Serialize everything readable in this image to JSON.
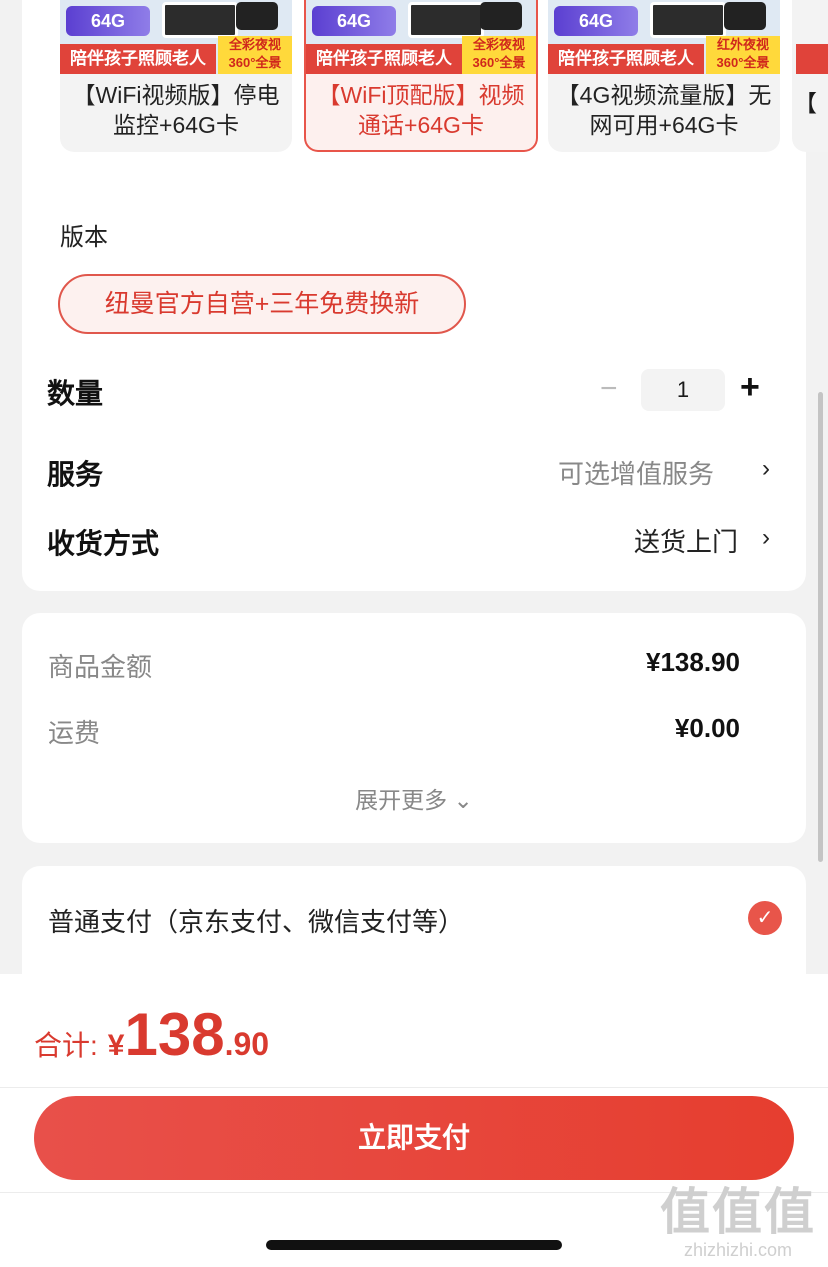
{
  "variants": [
    {
      "badge": "64G",
      "banner_left": "陪伴孩子照顾老人",
      "banner_right": "全彩夜视\n360°全景",
      "label": "【WiFi视频版】停电监控+64G卡",
      "selected": false
    },
    {
      "badge": "64G",
      "banner_left": "陪伴孩子照顾老人",
      "banner_right": "全彩夜视\n360°全景",
      "label": "【WiFi顶配版】视频通话+64G卡",
      "selected": true
    },
    {
      "badge": "64G",
      "banner_left": "陪伴孩子照顾老人",
      "banner_right": "红外夜视\n360°全景",
      "label": "【4G视频流量版】无网可用+64G卡",
      "selected": false
    },
    {
      "label": "【"
    }
  ],
  "version": {
    "title": "版本",
    "selected": "纽曼官方自营+三年免费换新"
  },
  "quantity": {
    "label": "数量",
    "minus": "−",
    "value": "1",
    "plus": "+"
  },
  "service": {
    "label": "服务",
    "value": "可选增值服务",
    "chevron": "›"
  },
  "delivery": {
    "label": "收货方式",
    "value": "送货上门",
    "chevron": "›"
  },
  "fees": {
    "goods_label": "商品金额",
    "goods_value": "¥138.90",
    "shipping_label": "运费",
    "shipping_value": "¥0.00",
    "expand": "展开更多 ⌄"
  },
  "payment": {
    "method": "普通支付（京东支付、微信支付等）",
    "check_icon": "check-circle-icon"
  },
  "total": {
    "label": "合计:",
    "currency": "¥",
    "integer": "138",
    "decimal": ".90"
  },
  "pay_button": "立即支付",
  "watermark": {
    "logo": "值值值",
    "url": "zhizhizhi.com"
  },
  "colors": {
    "accent": "#e8554a",
    "price": "#d93a2f"
  }
}
